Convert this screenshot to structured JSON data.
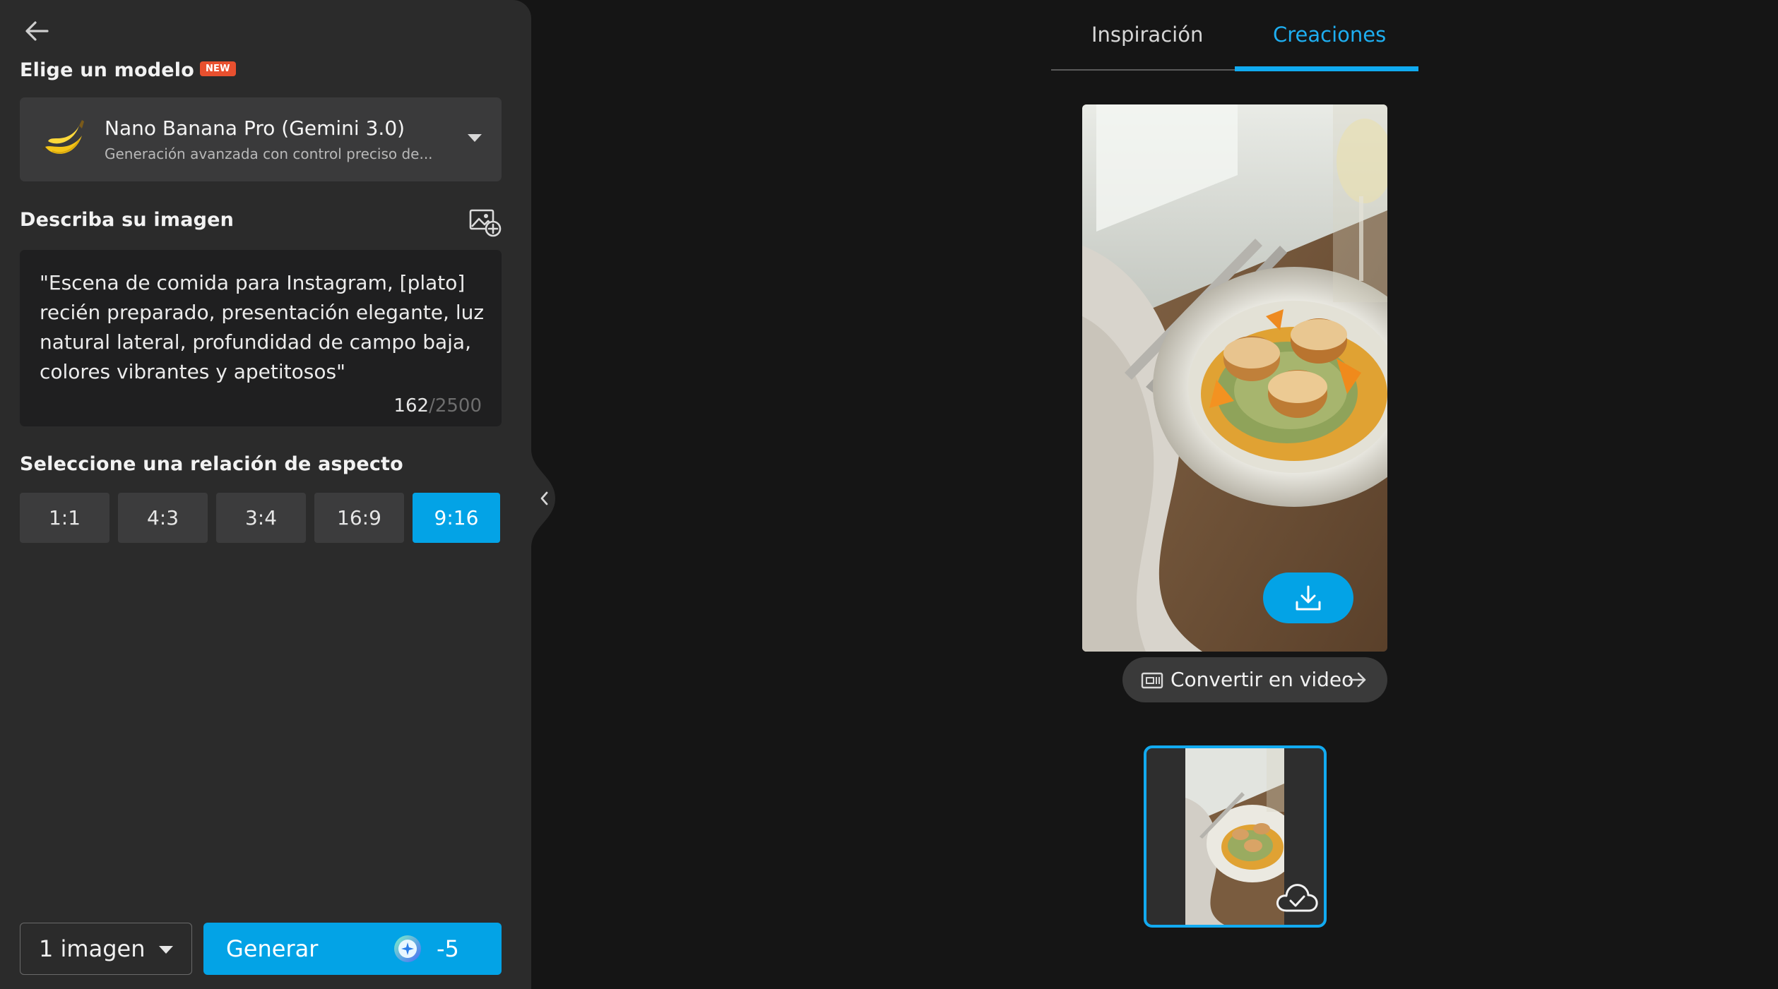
{
  "sidebar": {
    "back_icon": "arrow-left-icon",
    "model_section": {
      "title": "Elige un modelo",
      "badge": "NEW",
      "selected_model": {
        "icon": "banana-icon",
        "name": "Nano Banana Pro (Gemini 3.0)",
        "description": "Generación avanzada con control preciso de..."
      }
    },
    "prompt_section": {
      "title": "Describa su imagen",
      "add_image_icon": "image-plus-icon",
      "text": "\"Escena de comida para Instagram, [plato] recién preparado, presentación elegante, luz natural lateral, profundidad de campo baja, colores vibrantes y apetitosos\"",
      "char_used": "162",
      "char_max": "/2500"
    },
    "aspect_section": {
      "title": "Seleccione una relación de aspecto",
      "options": [
        "1:1",
        "4:3",
        "3:4",
        "16:9",
        "9:16"
      ],
      "selected": "9:16"
    },
    "image_count": "1 imagen",
    "generate": {
      "label": "Generar",
      "credit_icon": "sparkle-credit-icon",
      "cost": "-5"
    }
  },
  "main": {
    "tabs": [
      {
        "label": "Inspiración",
        "active": false
      },
      {
        "label": "Creaciones",
        "active": true
      }
    ],
    "result": {
      "download_icon": "download-icon",
      "convert_video_label": "Convertir en video"
    },
    "thumbnail": {
      "status_icon": "cloud-check-icon"
    }
  },
  "colors": {
    "accent": "#03a3e6",
    "panel": "#2b2b2b",
    "background": "#151515",
    "badge": "#e8502f"
  }
}
